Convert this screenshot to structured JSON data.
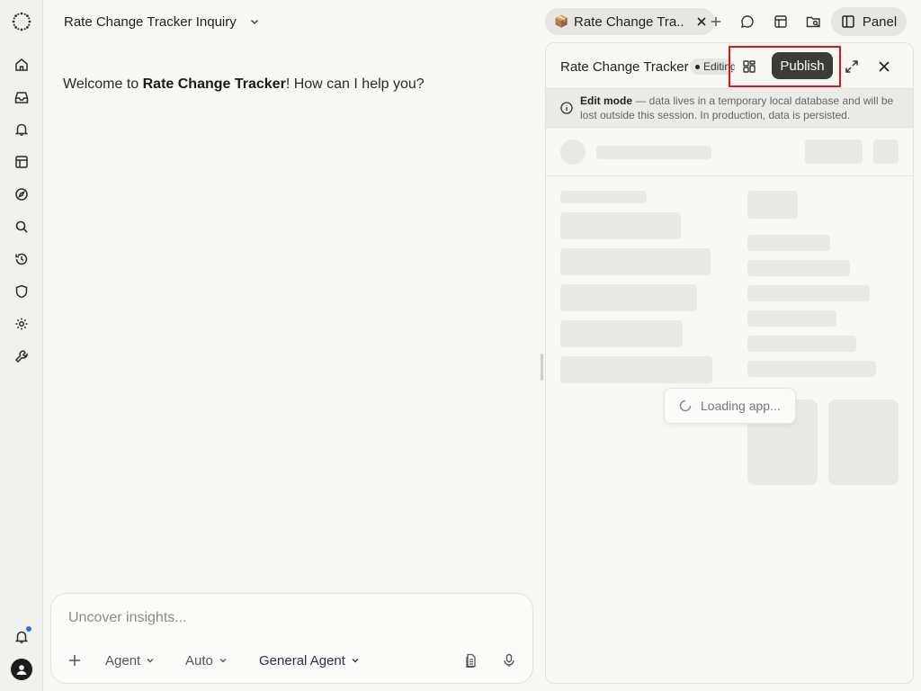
{
  "header": {
    "title": "Rate Change Tracker Inquiry",
    "tab_label": "Rate Change Tra...",
    "tab_icon": "package-icon",
    "panel_label": "Panel"
  },
  "sidebar": {
    "icons": [
      "logo-icon",
      "home-icon",
      "inbox-icon",
      "bell-icon",
      "layout-icon",
      "compass-icon",
      "search-icon",
      "history-icon",
      "shield-icon",
      "gear-icon",
      "wrench-icon",
      "notification-icon",
      "user-avatar-icon"
    ]
  },
  "chat": {
    "welcome_prefix": "Welcome to ",
    "welcome_app": "Rate Change Tracker",
    "welcome_suffix": "! How can I help you?"
  },
  "composer": {
    "placeholder": "Uncover insights...",
    "mode": "Agent",
    "model": "Auto",
    "agent": "General Agent"
  },
  "panel": {
    "title": "Rate Change Tracker",
    "badge": "Editing",
    "publish_label": "Publish",
    "banner_strong": "Edit mode",
    "banner_text": " — data lives in a temporary local database and will be lost outside this session. In production, data is persisted.",
    "loading_text": "Loading app..."
  },
  "colors": {
    "accent_dark": "#3b3b38",
    "highlight": "#e0141b",
    "notification_dot": "#2f6fe4"
  }
}
